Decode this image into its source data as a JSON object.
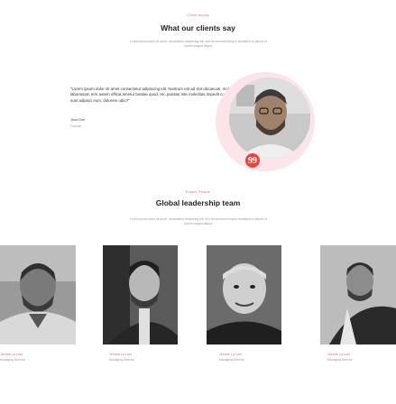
{
  "clients_section": {
    "eyebrow": "Client words",
    "title": "What our clients say",
    "description": "Lorem ipsum dolor sit amet, consectetur adipiscing elit, sed do eiusmod tempor incididunt ut labore et dolore magna aliqua."
  },
  "testimonial": {
    "quote": "“Lorem ipsum dolor sit amet consectetur adipiscing elit. Nostrum est ad sint obcaecati, molestiae distinctio quam laboriosam rem autem officia tenetur beatae quod. Hic pariatur iste molestias impedit corporis itaque! Aliquam modi sunt adipisci eum, dolorem odio?”",
    "author_name": "Jhon Doe",
    "author_role": "Founder",
    "quote_mark": "99"
  },
  "team_section": {
    "eyebrow": "Expert People",
    "title": "Global leadership team",
    "description": "Lorem ipsum dolor sit amet, consectetur adipiscing elit, sed do eiusmod tempor incididunt ut labore et dolore magna aliqua."
  },
  "team_members": [
    {
      "name": "Jerome La Lust",
      "role": "Managing Director"
    },
    {
      "name": "Jerome La Lust",
      "role": "Managing Director"
    },
    {
      "name": "Jerome La Lust",
      "role": "Managing Director"
    },
    {
      "name": "Jerome La Lust",
      "role": "Managing Director"
    }
  ],
  "colors": {
    "accent": "#e4677e",
    "quote_badge": "#e8463a",
    "circle_bg": "#fbe4ea"
  }
}
